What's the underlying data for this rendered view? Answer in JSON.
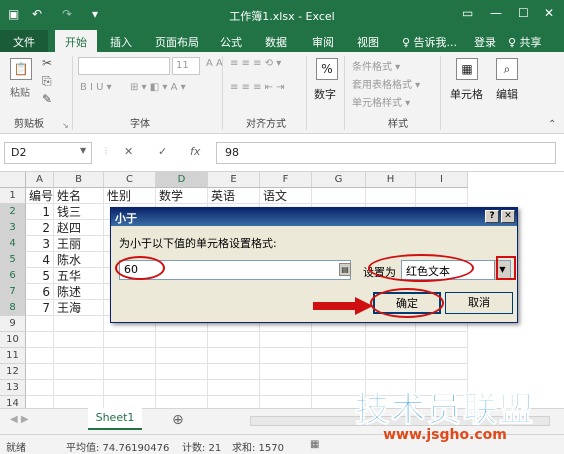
{
  "titlebar": {
    "title": "工作簿1.xlsx - Excel",
    "save_icon": "save-icon",
    "undo": "↶",
    "redo": "↷"
  },
  "ribbon_tabs": [
    "文件",
    "开始",
    "插入",
    "页面布局",
    "公式",
    "数据",
    "审阅",
    "视图",
    "♀ 告诉我...",
    "登录",
    "♀ 共享"
  ],
  "ribbon_groups": {
    "clipboard": "剪贴板",
    "font": "字体",
    "alignment": "对齐方式",
    "number": "数字",
    "styles": "样式",
    "cells": "单元格",
    "editing": "编辑"
  },
  "ribbon_buttons": {
    "paste": "粘贴",
    "font_size": "11",
    "number_percent": "%",
    "conditional_format": "条件格式 ▾",
    "table_format": "套用表格格式 ▾",
    "cell_style": "单元格样式 ▾"
  },
  "formula_bar": {
    "name_box": "D2",
    "fx": "fx",
    "cancel": "✕",
    "confirm": "✓",
    "value": "98"
  },
  "columns": [
    "A",
    "B",
    "C",
    "D",
    "E",
    "F",
    "G",
    "H",
    "I"
  ],
  "rows": [
    "1",
    "2",
    "3",
    "4",
    "5",
    "6",
    "7",
    "8",
    "9",
    "10",
    "11",
    "12",
    "13",
    "14"
  ],
  "table": {
    "headers": [
      "编号",
      "姓名",
      "性别",
      "数学",
      "英语",
      "语文"
    ],
    "ids": [
      "1",
      "2",
      "3",
      "4",
      "5",
      "6",
      "7"
    ],
    "names": [
      "钱三",
      "赵四",
      "王丽",
      "陈水",
      "五华",
      "陈述",
      "王海"
    ]
  },
  "dialog": {
    "title": "小于",
    "help": "?",
    "close": "✕",
    "prompt": "为小于以下值的单元格设置格式:",
    "input_value": "60",
    "set_as_label": "设置为",
    "format_value": "红色文本",
    "ok": "确定",
    "cancel": "取消"
  },
  "sheet_tab": "Sheet1",
  "add_sheet": "⊕",
  "status": {
    "mode": "就绪",
    "average": "平均值: 74.76190476",
    "count": "计数: 21",
    "sum": "求和: 1570"
  },
  "watermark": {
    "line1": "技术员联盟",
    "line2": "www.jsgho.com"
  },
  "colors": {
    "excel_green": "#217346",
    "annotation_red": "#d01010"
  }
}
